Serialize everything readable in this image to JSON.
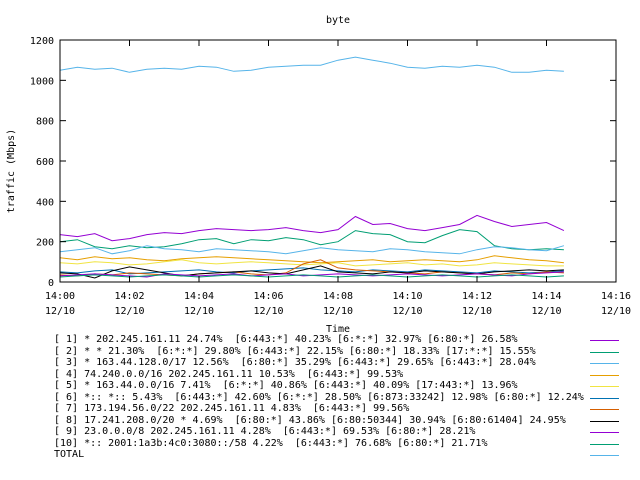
{
  "chart_data": {
    "type": "line",
    "title": "byte",
    "xlabel": "Time",
    "ylabel": "traffic (Mbps)",
    "ylim": [
      0,
      1200
    ],
    "yticks": [
      0,
      200,
      400,
      600,
      800,
      1000,
      1200
    ],
    "xlim": [
      0,
      16
    ],
    "xticks": [
      {
        "x": 0,
        "line1": "14:00",
        "line2": "12/10"
      },
      {
        "x": 2,
        "line1": "14:02",
        "line2": "12/10"
      },
      {
        "x": 4,
        "line1": "14:04",
        "line2": "12/10"
      },
      {
        "x": 6,
        "line1": "14:06",
        "line2": "12/10"
      },
      {
        "x": 8,
        "line1": "14:08",
        "line2": "12/10"
      },
      {
        "x": 10,
        "line1": "14:10",
        "line2": "12/10"
      },
      {
        "x": 12,
        "line1": "14:12",
        "line2": "12/10"
      },
      {
        "x": 14,
        "line1": "14:14",
        "line2": "12/10"
      },
      {
        "x": 16,
        "line1": "14:16",
        "line2": "12/10"
      }
    ],
    "grid": false,
    "legend_position": "bottom",
    "x": [
      0,
      0.5,
      1,
      1.5,
      2,
      2.5,
      3,
      3.5,
      4,
      4.5,
      5,
      5.5,
      6,
      6.5,
      7,
      7.5,
      8,
      8.5,
      9,
      9.5,
      10,
      10.5,
      11,
      11.5,
      12,
      12.5,
      13,
      13.5,
      14,
      14.5
    ],
    "series": [
      {
        "name": "[ 1] * 202.245.161.11 24.74%  [6:443:*] 40.23% [6:*:*] 32.97% [6:80:*] 26.58%",
        "color": "#9400d3",
        "values": [
          235,
          225,
          240,
          205,
          215,
          235,
          245,
          240,
          255,
          265,
          260,
          255,
          260,
          270,
          255,
          245,
          260,
          325,
          285,
          290,
          265,
          255,
          270,
          285,
          330,
          300,
          275,
          285,
          295,
          255
        ]
      },
      {
        "name": "[ 2] * * 21.30%  [6:*:*] 29.80% [6:443:*] 22.15% [6:80:*] 18.33% [17:*:*] 15.55%",
        "color": "#009e73",
        "values": [
          200,
          210,
          175,
          165,
          180,
          170,
          175,
          190,
          210,
          215,
          190,
          210,
          205,
          220,
          210,
          185,
          200,
          255,
          240,
          235,
          200,
          195,
          230,
          260,
          250,
          180,
          165,
          160,
          165,
          160
        ]
      },
      {
        "name": "[ 3] * 163.44.128.0/17 12.56%  [6:80:*] 35.29% [6:443:*] 29.65% [6:443:*] 28.04%",
        "color": "#56b4e9",
        "values": [
          150,
          160,
          170,
          140,
          155,
          180,
          165,
          160,
          150,
          165,
          160,
          155,
          150,
          140,
          155,
          170,
          160,
          155,
          150,
          165,
          160,
          150,
          145,
          140,
          160,
          175,
          170,
          160,
          155,
          180
        ]
      },
      {
        "name": "[ 4] 74.240.0.0/16 202.245.161.11 10.53%  [6:443:*] 99.53%",
        "color": "#e69f00",
        "values": [
          120,
          110,
          125,
          115,
          120,
          110,
          105,
          115,
          120,
          125,
          120,
          115,
          110,
          105,
          100,
          95,
          100,
          105,
          110,
          100,
          105,
          110,
          105,
          100,
          110,
          130,
          120,
          110,
          105,
          95
        ]
      },
      {
        "name": "[ 5] * 163.44.0.0/16 7.41%  [6:*:*] 40.86% [6:443:*] 40.09% [17:443:*] 13.96%",
        "color": "#f0e442",
        "values": [
          95,
          90,
          100,
          95,
          85,
          90,
          100,
          110,
          95,
          90,
          95,
          100,
          95,
          90,
          85,
          90,
          95,
          80,
          85,
          90,
          95,
          85,
          90,
          80,
          85,
          95,
          90,
          85,
          80,
          80
        ]
      },
      {
        "name": "[ 6] *:: *:: 5.43%  [6:443:*] 42.60% [6:*:*] 28.50% [6:873:33242] 12.98% [6:80:*] 12.24%",
        "color": "#0072b2",
        "values": [
          50,
          45,
          55,
          60,
          40,
          45,
          50,
          55,
          60,
          50,
          45,
          55,
          60,
          65,
          70,
          60,
          55,
          50,
          60,
          55,
          50,
          60,
          55,
          50,
          45,
          55,
          50,
          45,
          50,
          55
        ]
      },
      {
        "name": "[ 7] 173.194.56.0/22 202.245.161.11 4.83%  [6:443:*] 99.56%",
        "color": "#d55e00",
        "values": [
          35,
          30,
          40,
          35,
          45,
          40,
          35,
          30,
          40,
          45,
          50,
          40,
          35,
          45,
          90,
          110,
          70,
          60,
          55,
          50,
          45,
          40,
          50,
          45,
          40,
          35,
          45,
          40,
          50,
          45
        ]
      },
      {
        "name": "[ 8] 17.241.208.0/20 * 4.69%  [6:80:*] 43.86% [6:80:50344] 30.94% [6:80:61404] 24.95%",
        "color": "#000000",
        "values": [
          45,
          40,
          20,
          55,
          75,
          60,
          45,
          30,
          40,
          45,
          50,
          55,
          45,
          40,
          60,
          80,
          50,
          45,
          40,
          50,
          45,
          55,
          50,
          45,
          40,
          50,
          55,
          60,
          55,
          60
        ]
      },
      {
        "name": "[ 9] 23.0.0.0/8 202.245.161.11 4.28%  [6:443:*] 69.53% [6:80:*] 28.21%",
        "color": "#9400d3",
        "values": [
          30,
          35,
          40,
          35,
          30,
          25,
          40,
          35,
          30,
          35,
          40,
          30,
          35,
          40,
          30,
          35,
          40,
          35,
          30,
          35,
          40,
          35,
          30,
          35,
          40,
          35,
          30,
          40,
          45,
          50
        ]
      },
      {
        "name": "[10] *:: 2001:1a3b:4c0:3080::/58 4.22%  [6:443:*] 76.68% [6:80:*] 21.71%",
        "color": "#009e73",
        "values": [
          25,
          30,
          35,
          30,
          25,
          30,
          35,
          30,
          25,
          30,
          35,
          30,
          25,
          30,
          35,
          30,
          25,
          30,
          35,
          30,
          25,
          30,
          35,
          30,
          25,
          30,
          35,
          30,
          25,
          30
        ]
      },
      {
        "name": "TOTAL",
        "color": "#56b4e9",
        "values": [
          1050,
          1065,
          1055,
          1060,
          1040,
          1055,
          1060,
          1055,
          1070,
          1065,
          1045,
          1050,
          1065,
          1070,
          1075,
          1075,
          1100,
          1115,
          1100,
          1085,
          1065,
          1060,
          1070,
          1065,
          1075,
          1065,
          1040,
          1040,
          1050,
          1045
        ]
      }
    ]
  }
}
